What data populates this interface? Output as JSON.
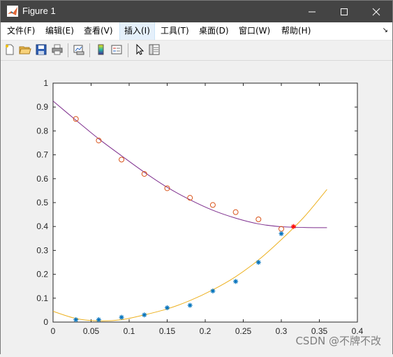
{
  "window": {
    "title": "Figure 1",
    "minimize_icon": "minimize-icon",
    "maximize_icon": "maximize-icon",
    "close_icon": "close-icon"
  },
  "menu": {
    "items": [
      {
        "label": "文件(F)"
      },
      {
        "label": "编辑(E)"
      },
      {
        "label": "查看(V)"
      },
      {
        "label": "插入(I)"
      },
      {
        "label": "工具(T)"
      },
      {
        "label": "桌面(D)"
      },
      {
        "label": "窗口(W)"
      },
      {
        "label": "帮助(H)"
      }
    ],
    "overflow_icon": "dock-arrow-icon"
  },
  "toolbar": {
    "buttons": [
      "new-figure-icon",
      "open-file-icon",
      "save-icon",
      "print-icon",
      "link-plot-icon",
      "colorbar-icon",
      "legend-icon",
      "edit-plot-icon",
      "property-inspector-icon"
    ]
  },
  "watermark": "CSDN @不牌不改",
  "colors": {
    "purple": "#7e2f8e",
    "orange": "#edb120",
    "red_circle": "#d95319",
    "blue_star": "#0072bd",
    "red_star": "#ff0000"
  },
  "chart_data": {
    "type": "scatter",
    "title": "",
    "xlabel": "",
    "ylabel": "",
    "xlim": [
      0,
      0.4
    ],
    "ylim": [
      0,
      1
    ],
    "xticks": [
      "0",
      "0.05",
      "0.1",
      "0.15",
      "0.2",
      "0.25",
      "0.3",
      "0.35",
      "0.4"
    ],
    "yticks": [
      "0",
      "0.1",
      "0.2",
      "0.3",
      "0.4",
      "0.5",
      "0.6",
      "0.7",
      "0.8",
      "0.9",
      "1"
    ],
    "grid": false,
    "series": [
      {
        "marker": "circle",
        "color": "#d95319",
        "x": [
          0.03,
          0.06,
          0.09,
          0.12,
          0.15,
          0.18,
          0.21,
          0.24,
          0.27,
          0.3
        ],
        "y": [
          0.85,
          0.76,
          0.68,
          0.62,
          0.56,
          0.52,
          0.49,
          0.46,
          0.43,
          0.39
        ]
      },
      {
        "marker": "star",
        "color": "#0072bd",
        "x": [
          0.03,
          0.06,
          0.09,
          0.12,
          0.15,
          0.18,
          0.21,
          0.24,
          0.27,
          0.3
        ],
        "y": [
          0.01,
          0.01,
          0.02,
          0.03,
          0.06,
          0.07,
          0.13,
          0.17,
          0.25,
          0.37
        ]
      },
      {
        "line": "curve",
        "color": "#7e2f8e",
        "x": [
          0,
          0.03,
          0.06,
          0.09,
          0.12,
          0.15,
          0.18,
          0.21,
          0.24,
          0.27,
          0.3,
          0.33,
          0.36
        ],
        "y": [
          0.925,
          0.845,
          0.767,
          0.696,
          0.627,
          0.564,
          0.512,
          0.468,
          0.435,
          0.411,
          0.399,
          0.396,
          0.395
        ]
      },
      {
        "line": "curve",
        "color": "#edb120",
        "x": [
          0,
          0.03,
          0.06,
          0.09,
          0.12,
          0.15,
          0.18,
          0.21,
          0.24,
          0.27,
          0.3,
          0.33,
          0.36
        ],
        "y": [
          0.045,
          0.015,
          0.005,
          0.01,
          0.03,
          0.055,
          0.09,
          0.135,
          0.19,
          0.26,
          0.345,
          0.44,
          0.555
        ]
      },
      {
        "marker": "star",
        "color": "#ff0000",
        "x": [
          0.316
        ],
        "y": [
          0.4
        ]
      }
    ]
  }
}
